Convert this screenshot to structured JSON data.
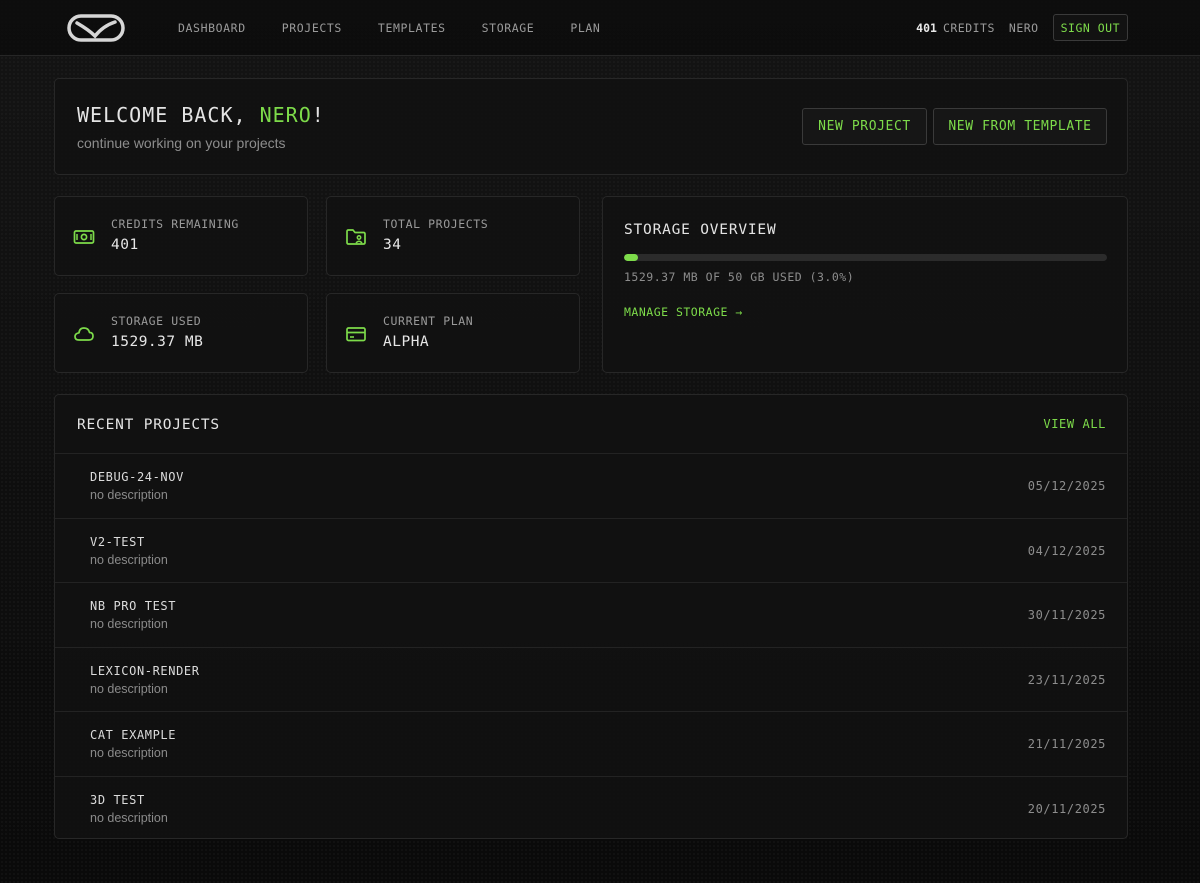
{
  "nav": {
    "items": [
      "DASHBOARD",
      "PROJECTS",
      "TEMPLATES",
      "STORAGE",
      "PLAN"
    ],
    "credits_value": "401",
    "credits_label": "CREDITS",
    "username": "NERO",
    "sign_out": "SIGN OUT"
  },
  "welcome": {
    "title_prefix": "WELCOME BACK, ",
    "title_name": "NERO",
    "title_suffix": "!",
    "subtitle": "continue working on your projects",
    "new_project": "NEW PROJECT",
    "new_from_template": "NEW FROM TEMPLATE"
  },
  "stats": [
    {
      "label": "CREDITS REMAINING",
      "value": "401",
      "icon": "money-icon"
    },
    {
      "label": "TOTAL PROJECTS",
      "value": "34",
      "icon": "folder-user-icon"
    },
    {
      "label": "STORAGE USED",
      "value": "1529.37 MB",
      "icon": "cloud-icon"
    },
    {
      "label": "CURRENT PLAN",
      "value": "ALPHA",
      "icon": "credit-card-icon"
    }
  ],
  "storage": {
    "title": "STORAGE OVERVIEW",
    "usage_text": "1529.37 MB OF 50 GB USED (3.0%)",
    "usage_fraction": 0.03,
    "manage_link": "MANAGE STORAGE →"
  },
  "recent": {
    "title": "RECENT PROJECTS",
    "view_all": "VIEW ALL",
    "projects": [
      {
        "name": "DEBUG-24-NOV",
        "description": "no description",
        "date": "05/12/2025"
      },
      {
        "name": "V2-TEST",
        "description": "no description",
        "date": "04/12/2025"
      },
      {
        "name": "NB PRO TEST",
        "description": "no description",
        "date": "30/11/2025"
      },
      {
        "name": "LEXICON-RENDER",
        "description": "no description",
        "date": "23/11/2025"
      },
      {
        "name": "CAT EXAMPLE",
        "description": "no description",
        "date": "21/11/2025"
      },
      {
        "name": "3D TEST",
        "description": "no description",
        "date": "20/11/2025"
      }
    ]
  },
  "colors": {
    "accent": "#7ddb4a",
    "background": "#0b0b0b",
    "card": "#111111"
  }
}
